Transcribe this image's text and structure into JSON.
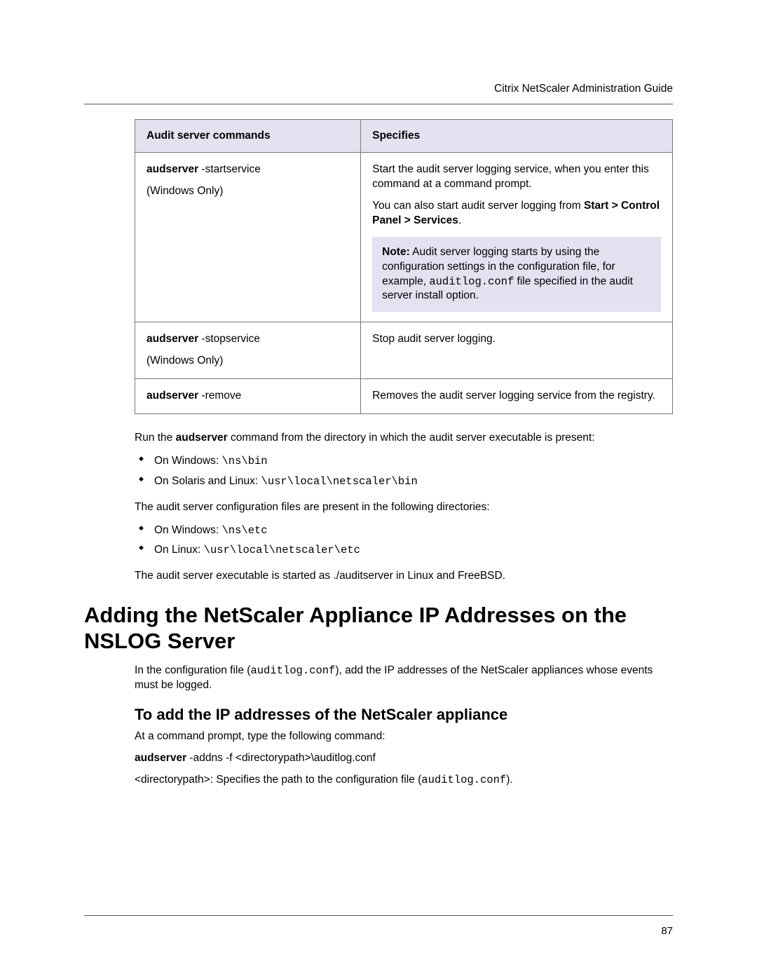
{
  "header": {
    "title": "Citrix NetScaler Administration Guide"
  },
  "table": {
    "headers": {
      "col1": "Audit server commands",
      "col2": "Specifies"
    },
    "rows": [
      {
        "cmd_bold": "audserver",
        "cmd_rest": " -startservice",
        "cmd_note": "(Windows Only)",
        "desc1a": "Start the audit server logging service, when you enter this command at a command prompt.",
        "desc2a": "You can also start audit server logging from ",
        "desc2b": "Start > Control Panel > Services",
        "desc2c": ".",
        "note_label": "Note:",
        "note_a": "  Audit server logging starts by using the configuration settings in the configuration file, for example, ",
        "note_code": "auditlog.conf",
        "note_b": " file specified in the audit server install option."
      },
      {
        "cmd_bold": "audserver",
        "cmd_rest": " -stopservice",
        "cmd_note": "(Windows Only)",
        "desc": "Stop audit server logging."
      },
      {
        "cmd_bold": "audserver",
        "cmd_rest": " -remove",
        "desc": "Removes the audit server logging service from the registry."
      }
    ]
  },
  "body": {
    "p1a": "Run the ",
    "p1b": "audserver",
    "p1c": " command from the directory in which the audit server executable is present:",
    "list1": [
      {
        "text": "On Windows: ",
        "code": "\\ns\\bin"
      },
      {
        "text": "On Solaris and Linux: ",
        "code": "\\usr\\local\\netscaler\\bin"
      }
    ],
    "p2": "The audit server configuration files are present in the following directories:",
    "list2": [
      {
        "text": "On Windows: ",
        "code": "\\ns\\etc"
      },
      {
        "text": "On Linux: ",
        "code": "\\usr\\local\\netscaler\\etc"
      }
    ],
    "p3": "The audit server executable is started as ./auditserver in Linux and FreeBSD."
  },
  "section": {
    "h1": "Adding the NetScaler Appliance IP Addresses on the NSLOG Server",
    "p1a": "In the configuration file (",
    "p1code": "auditlog.conf",
    "p1b": "), add the IP addresses of the NetScaler appliances whose events must be logged.",
    "h2": "To add the IP addresses of the NetScaler appliance",
    "p2": "At a command prompt, type the following command:",
    "cmd_bold": "audserver",
    "cmd_rest": " -addns -f <directorypath>\\auditlog.conf",
    "p3a": "<directorypath>: Specifies the path to the configuration file (",
    "p3code": "auditlog.conf",
    "p3b": ")."
  },
  "footer": {
    "page": "87"
  }
}
